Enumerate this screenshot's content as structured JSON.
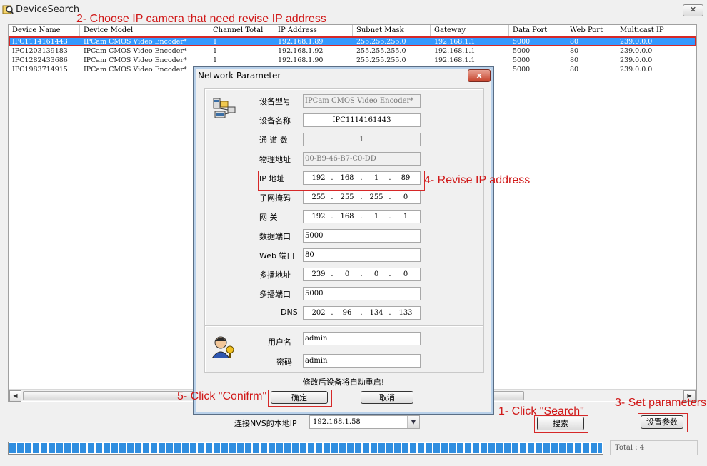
{
  "window": {
    "title": "DeviceSearch",
    "close_label": "✕"
  },
  "annotations": {
    "step1": "1- Click \"Search\"",
    "step2": "2- Choose IP camera that need revise IP address",
    "step3": "3- Set parameters",
    "step4": "4- Revise IP address",
    "step5": "5- Click \"Conifrm\""
  },
  "table": {
    "columns": [
      "Device Name",
      "Device Model",
      "Channel Total",
      "IP Address",
      "Subnet Mask",
      "Gateway",
      "Data Port",
      "Web Port",
      "Multicast IP"
    ],
    "rows": [
      [
        "IPC1114161443",
        "IPCam CMOS Video Encoder*",
        "1",
        "192.168.1.89",
        "255.255.255.0",
        "192.168.1.1",
        "5000",
        "80",
        "239.0.0.0"
      ],
      [
        "IPC1203139183",
        "IPCam CMOS Video Encoder*",
        "1",
        "192.168.1.92",
        "255.255.255.0",
        "192.168.1.1",
        "5000",
        "80",
        "239.0.0.0"
      ],
      [
        "IPC1282433686",
        "IPCam CMOS Video Encoder*",
        "1",
        "192.168.1.90",
        "255.255.255.0",
        "192.168.1.1",
        "5000",
        "80",
        "239.0.0.0"
      ],
      [
        "IPC1983714915",
        "IPCam CMOS Video Encoder*",
        "1",
        "",
        "",
        "",
        "5000",
        "80",
        "239.0.0.0"
      ]
    ]
  },
  "dialog": {
    "title": "Network Parameter",
    "close_label": "x",
    "labels": {
      "model": "设备型号",
      "name": "设备名称",
      "channels": "通 道 数",
      "mac": "物理地址",
      "ip": "IP  地址",
      "mask": "子网掩码",
      "gateway": "网    关",
      "data_port": "数据端口",
      "web_port": "Web 端口",
      "multicast": "多播地址",
      "multicast_port": "多播端口",
      "dns": "DNS",
      "user": "用户名",
      "password": "密码"
    },
    "values": {
      "model": "IPCam CMOS Video Encoder*",
      "name": "IPC1114161443",
      "channels": "1",
      "mac": "00-B9-46-B7-C0-DD",
      "ip": [
        "192",
        "168",
        "1",
        "89"
      ],
      "mask": [
        "255",
        "255",
        "255",
        "0"
      ],
      "gateway": [
        "192",
        "168",
        "1",
        "1"
      ],
      "data_port": "5000",
      "web_port": "80",
      "multicast": [
        "239",
        "0",
        "0",
        "0"
      ],
      "multicast_port": "5000",
      "dns": [
        "202",
        "96",
        "134",
        "133"
      ],
      "user": "admin",
      "password": "admin"
    },
    "note": "修改后设备将自动重启!",
    "ok_label": "确定",
    "cancel_label": "取消"
  },
  "bottom": {
    "local_ip_label": "连接NVS的本地IP",
    "local_ip_value": "192.168.1.58",
    "search_label": "搜索",
    "set_params_label": "设置参数",
    "total_text": "Total : 4",
    "progress": 1.0
  }
}
